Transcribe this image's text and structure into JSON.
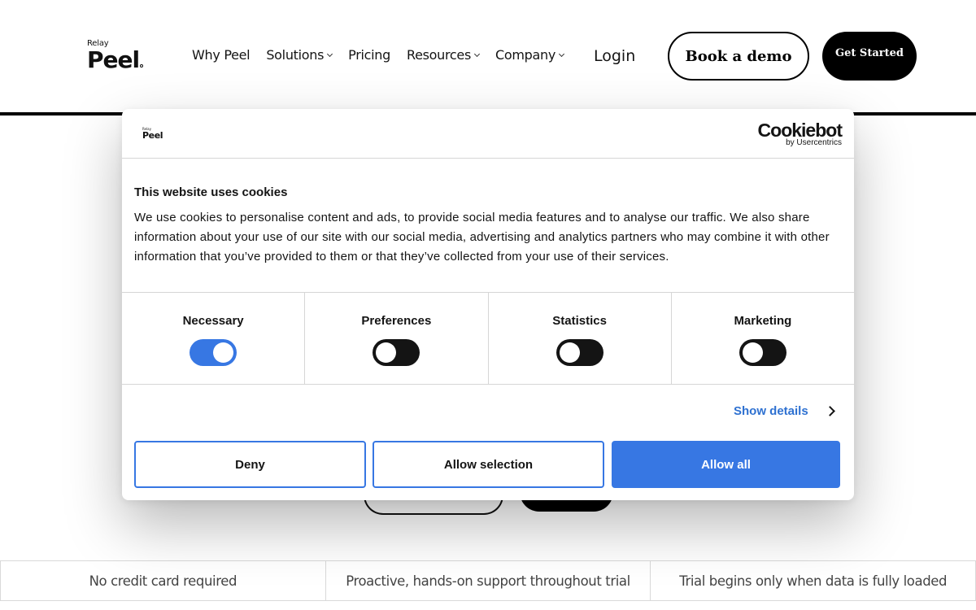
{
  "header": {
    "logo": {
      "small": "Relay",
      "big": "Peel"
    },
    "nav": [
      {
        "label": "Why Peel",
        "dropdown": false
      },
      {
        "label": "Solutions",
        "dropdown": true
      },
      {
        "label": "Pricing",
        "dropdown": false
      },
      {
        "label": "Resources",
        "dropdown": true
      },
      {
        "label": "Company",
        "dropdown": true
      }
    ],
    "login": "Login",
    "book_demo": "Book a demo",
    "get_started": "Get Started"
  },
  "features": [
    "No credit card required",
    "Proactive, hands-on support throughout  trial",
    "Trial begins only when data is fully loaded"
  ],
  "cookie": {
    "logo": {
      "small": "Relay",
      "big": "Peel"
    },
    "brand": {
      "name": "Cookiebot",
      "by": "by Usercentrics"
    },
    "title": "This website uses cookies",
    "body": "We use cookies to personalise content and ads, to provide social media features and to analyse our traffic. We also share information about your use of our site with our social media, advertising and analytics partners who may combine it with other information that you’ve provided to them or that they’ve collected from your use of their services.",
    "categories": [
      {
        "label": "Necessary",
        "enabled": true
      },
      {
        "label": "Preferences",
        "enabled": false
      },
      {
        "label": "Statistics",
        "enabled": false
      },
      {
        "label": "Marketing",
        "enabled": false
      }
    ],
    "show_details": "Show details",
    "buttons": {
      "deny": "Deny",
      "allow_selection": "Allow selection",
      "allow_all": "Allow all"
    }
  },
  "colors": {
    "accent": "#3777e3",
    "link": "#2e71d1",
    "dark": "#141414",
    "toggle_off": "#141414"
  }
}
